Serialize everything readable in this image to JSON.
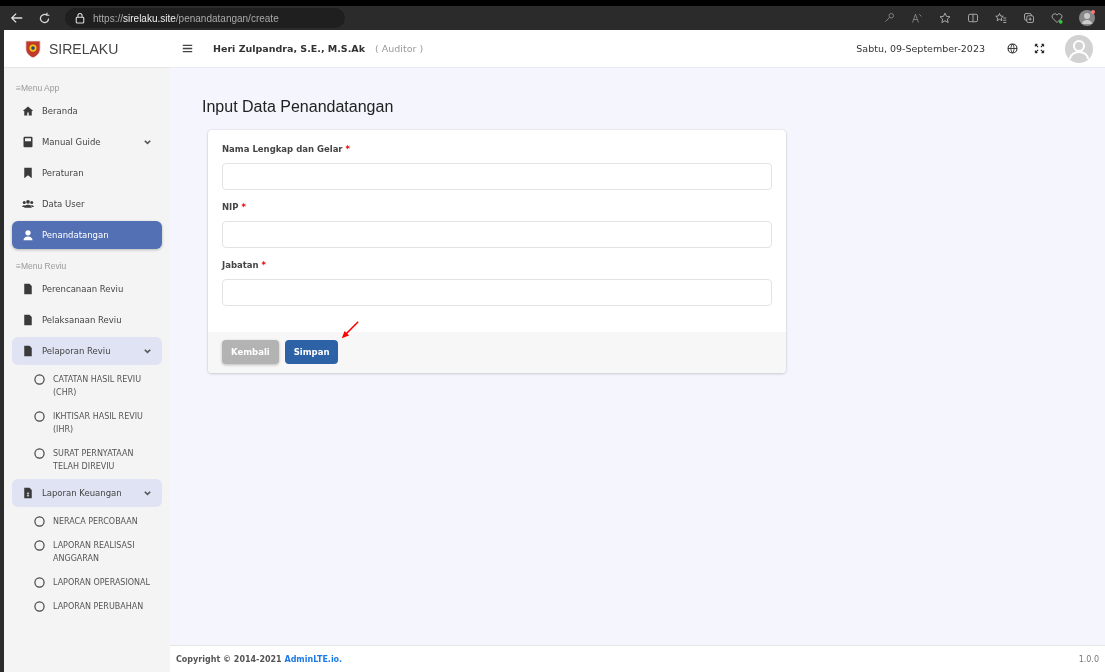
{
  "browser": {
    "url": "https://**sirelaku.site**/penandatangan/create"
  },
  "brand": "SIRELAKU",
  "header": {
    "user": "Heri Zulpandra, S.E., M.S.Ak",
    "role": "( Auditor )",
    "date": "Sabtu, 09-September-2023"
  },
  "sidebar": {
    "items": [
      {
        "kind": "header",
        "label": "≡Menu App"
      },
      {
        "kind": "item",
        "label": "Beranda",
        "selected": false
      },
      {
        "kind": "group",
        "label": "Manual Guide",
        "selected": false,
        "expanded": false
      },
      {
        "kind": "item",
        "label": "Peraturan",
        "selected": false
      },
      {
        "kind": "item",
        "label": "Data User",
        "selected": false
      },
      {
        "kind": "item",
        "label": "Penandatangan",
        "selected": true
      },
      {
        "kind": "header",
        "label": "≡Menu Reviu"
      },
      {
        "kind": "item",
        "label": "Perencanaan Reviu",
        "selected": false
      },
      {
        "kind": "item",
        "label": "Pelaksanaan Reviu",
        "selected": false
      },
      {
        "kind": "group",
        "label": "Pelaporan Reviu",
        "selected": false,
        "expanded": true,
        "children": [
          {
            "label": "CATATAN HASIL REVIU (CHR)",
            "selected": false
          },
          {
            "label": "IKHTISAR HASIL REVIU (IHR)",
            "selected": false
          },
          {
            "label": "SURAT PERNYATAAN TELAH DIREVIU",
            "selected": false
          }
        ]
      },
      {
        "kind": "group",
        "label": "Laporan Keuangan",
        "selected": false,
        "expanded": true,
        "children": [
          {
            "label": "NERACA PERCOBAAN",
            "selected": false
          },
          {
            "label": "LAPORAN REALISASI ANGGARAN",
            "selected": false
          },
          {
            "label": "LAPORAN OPERASIONAL",
            "selected": false
          },
          {
            "label": "LAPORAN PERUBAHAN",
            "selected": false
          }
        ]
      }
    ]
  },
  "page_title": "Input Data Penandatangan",
  "form": {
    "fields": [
      {
        "label": "Nama Lengkap dan Gelar",
        "required_mark": "*"
      },
      {
        "label": "NIP",
        "required_mark": "*"
      },
      {
        "label": "Jabatan",
        "required_mark": "*"
      }
    ],
    "buttons": [
      {
        "label": "Kembali",
        "kind": "secondary"
      },
      {
        "label": "Simpan",
        "kind": "primary"
      }
    ]
  },
  "footer": {
    "copyright": "Copyright © 2014-2021",
    "link": "AdminLTE.io.",
    "version": "1.0.0"
  }
}
